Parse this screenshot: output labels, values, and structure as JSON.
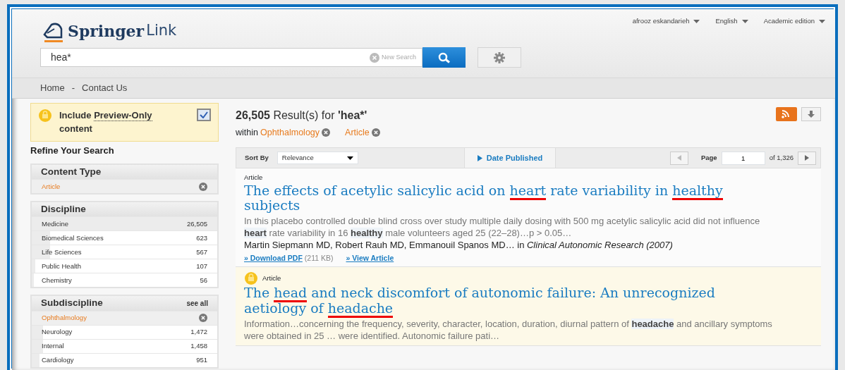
{
  "header": {
    "logo_main": "Springer",
    "logo_sub": "Link",
    "account_menus": [
      {
        "label": "afrooz eskandarieh"
      },
      {
        "label": "English"
      },
      {
        "label": "Academic edition"
      }
    ],
    "search": {
      "value": "hea*",
      "clear_label": "New Search"
    }
  },
  "nav": {
    "links": [
      {
        "label": "Home"
      },
      {
        "label": "Contact Us"
      }
    ],
    "separator": "-"
  },
  "sidebar": {
    "preview": {
      "label_start": "Include ",
      "label_link": "Preview-Only",
      "label_end": " content",
      "checked": true
    },
    "refine_title": "Refine Your Search",
    "facets": [
      {
        "title": "Content Type",
        "items": [
          {
            "label": "Article",
            "selected": true
          }
        ]
      },
      {
        "title": "Discipline",
        "items": [
          {
            "label": "Medicine",
            "count": "26,505",
            "selected": false,
            "level": 1
          },
          {
            "label": "Biomedical Sciences",
            "count": "623",
            "selected": false,
            "level": 0.1
          },
          {
            "label": "Life Sciences",
            "count": "567",
            "selected": false,
            "level": 0.1
          },
          {
            "label": "Public Health",
            "count": "107",
            "selected": false,
            "level": 0.02
          },
          {
            "label": "Chemistry",
            "count": "56",
            "selected": false,
            "level": 0.01
          }
        ]
      },
      {
        "title": "Subdiscipline",
        "see_all": "see all",
        "items": [
          {
            "label": "Ophthalmology",
            "selected": true
          },
          {
            "label": "Neurology",
            "count": "1,472",
            "selected": false,
            "level": 0.06
          },
          {
            "label": "Internal",
            "count": "1,458",
            "selected": false,
            "level": 0.06
          },
          {
            "label": "Cardiology",
            "count": "951",
            "selected": false,
            "level": 0.04
          }
        ]
      }
    ]
  },
  "results": {
    "count": "26,505",
    "count_label": "Result(s)",
    "for_label": "for",
    "query": "'hea*'",
    "within_label": "within",
    "filters": [
      {
        "label": "Ophthalmology"
      },
      {
        "label": "Article"
      }
    ],
    "sort_label": "Sort By",
    "sort_value": "Relevance",
    "date_label": "Date Published",
    "page_label": "Page",
    "page_value": "1",
    "page_total": "of 1,326",
    "items": [
      {
        "kind": "full",
        "type": "Article",
        "preview_only": false,
        "title": [
          {
            "text": "The effects of acetylic salicylic acid on ",
            "marked": false
          },
          {
            "text": "heart",
            "marked": true
          },
          {
            "text": " rate variability in ",
            "marked": false
          },
          {
            "text": "healthy",
            "marked": true
          },
          {
            "text": " subjects",
            "marked": false
          }
        ],
        "snippet": "In this placebo controlled double blind cross over study multiple daily dosing with 500 mg acetylic salicylic acid did not influence **heart** rate variability in 16 **healthy** male volunteers aged 25 (22–28)…p > 0.05…",
        "authors": "Martin Siepmann MD, Robert Rauh MD, Emmanouil Spanos MD… in *Clinical Autonomic Research (2007)*",
        "download": "» Download PDF",
        "size": "(211 KB)",
        "view": "» View Article"
      },
      {
        "kind": "preview",
        "type": "Article",
        "preview_only": true,
        "title": [
          {
            "text": "The ",
            "marked": false
          },
          {
            "text": "head",
            "marked": true
          },
          {
            "text": " and neck discomfort of autonomic failure: An unrecognized aetiology of ",
            "marked": false
          },
          {
            "text": "headache",
            "marked": true
          }
        ],
        "snippet": "Information…concerning the frequency, severity, character, location, duration, diurnal pattern of **headache** and ancillary symptoms were obtained in 25 … were identified. Autonomic failure pati…"
      }
    ]
  }
}
